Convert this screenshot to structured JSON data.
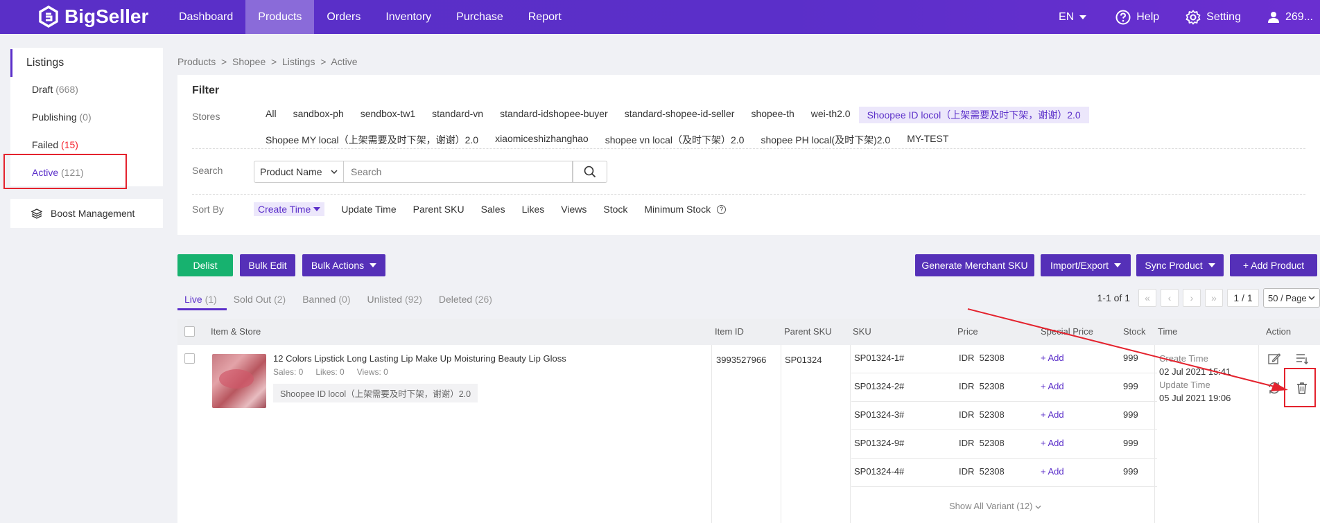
{
  "topbar": {
    "brand": "BigSeller",
    "nav": [
      "Dashboard",
      "Products",
      "Orders",
      "Inventory",
      "Purchase",
      "Report"
    ],
    "active_nav": "Products",
    "lang": "EN",
    "help": "Help",
    "setting": "Setting",
    "user": "269..."
  },
  "sidebar": {
    "title": "Listings",
    "items": [
      {
        "label": "Draft",
        "count": "(668)"
      },
      {
        "label": "Publishing",
        "count": "(0)"
      },
      {
        "label": "Failed",
        "count": "(15)"
      },
      {
        "label": "Active",
        "count": "(121)"
      }
    ],
    "boost": "Boost Management"
  },
  "breadcrumb": "Products  >  Shopee  >  Listings  >  Active",
  "filter": {
    "title": "Filter",
    "stores_label": "Stores",
    "stores": [
      "All",
      "sandbox-ph",
      "sendbox-tw1",
      "standard-vn",
      "standard-idshopee-buyer",
      "standard-shopee-id-seller",
      "shopee-th",
      "wei-th2.0",
      "Shoopee ID locol（上架需要及时下架，谢谢）2.0",
      "Shopee MY local（上架需要及时下架，谢谢）2.0",
      "xiaomiceshizhanghao",
      "shopee vn local（及时下架）2.0",
      "shopee PH local(及时下架)2.0",
      "MY-TEST"
    ],
    "active_store": "Shoopee ID locol（上架需要及时下架，谢谢）2.0",
    "search_label": "Search",
    "search_type": "Product Name",
    "search_placeholder": "Search",
    "sort_label": "Sort By",
    "sorts": [
      "Create Time",
      "Update Time",
      "Parent SKU",
      "Sales",
      "Likes",
      "Views",
      "Stock",
      "Minimum Stock"
    ]
  },
  "actions": {
    "delist": "Delist",
    "bulk_edit": "Bulk Edit",
    "bulk_actions": "Bulk Actions",
    "generate_sku": "Generate Merchant SKU",
    "import_export": "Import/Export",
    "sync": "Sync Product",
    "add": "+ Add Product"
  },
  "tabs": [
    {
      "label": "Live",
      "count": "(1)"
    },
    {
      "label": "Sold Out",
      "count": "(2)"
    },
    {
      "label": "Banned",
      "count": "(0)"
    },
    {
      "label": "Unlisted",
      "count": "(92)"
    },
    {
      "label": "Deleted",
      "count": "(26)"
    }
  ],
  "pager": {
    "summary": "1-1 of 1",
    "page": "1 / 1",
    "per_page": "50 / Page"
  },
  "table": {
    "headers": {
      "item": "Item & Store",
      "item_id": "Item ID",
      "parent_sku": "Parent SKU",
      "sku": "SKU",
      "price": "Price",
      "special": "Special Price",
      "stock": "Stock",
      "time": "Time",
      "action": "Action"
    },
    "product": {
      "name": "12 Colors Lipstick Long Lasting Lip Make Up Moisturing Beauty Lip Gloss",
      "sales": "Sales: 0",
      "likes": "Likes: 0",
      "views": "Views: 0",
      "store": "Shoopee ID locol（上架需要及时下架，谢谢）2.0",
      "item_id": "3993527966",
      "parent_sku": "SP01324",
      "create_label": "Create Time",
      "create_time": "02 Jul 2021 15:41",
      "update_label": "Update Time",
      "update_time": "05 Jul 2021 19:06"
    },
    "variants": [
      {
        "sku": "SP01324-1#",
        "price": "IDR  52308",
        "special": "+ Add",
        "stock": "999"
      },
      {
        "sku": "SP01324-2#",
        "price": "IDR  52308",
        "special": "+ Add",
        "stock": "999"
      },
      {
        "sku": "SP01324-3#",
        "price": "IDR  52308",
        "special": "+ Add",
        "stock": "999"
      },
      {
        "sku": "SP01324-9#",
        "price": "IDR  52308",
        "special": "+ Add",
        "stock": "999"
      },
      {
        "sku": "SP01324-4#",
        "price": "IDR  52308",
        "special": "+ Add",
        "stock": "999"
      }
    ],
    "show_all": "Show All Variant (12)"
  },
  "colors": {
    "brand": "#5b2fc9",
    "green": "#17b26f",
    "annotation_red": "#e4222d"
  }
}
